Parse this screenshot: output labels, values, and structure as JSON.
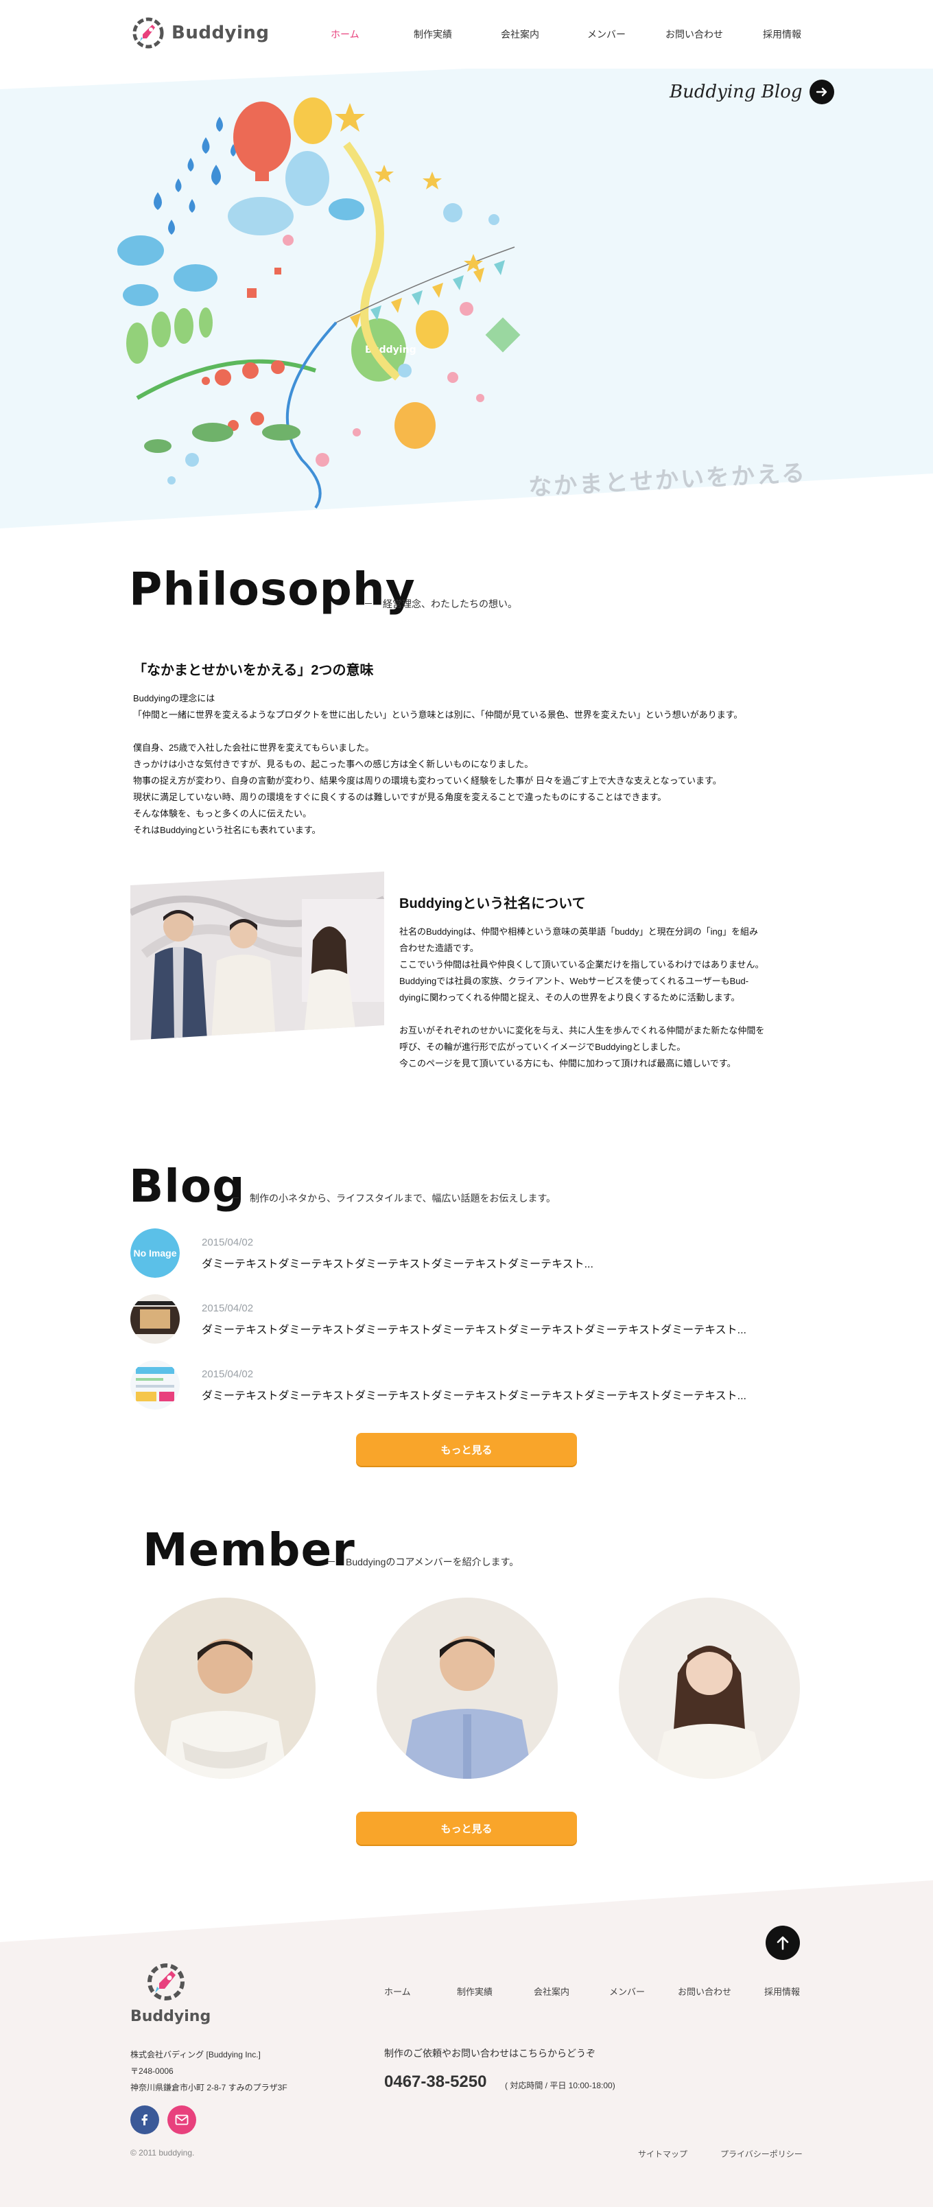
{
  "header": {
    "logo_text": "Buddying",
    "nav": [
      {
        "label": "ホーム",
        "active": true
      },
      {
        "label": "制作実績",
        "active": false
      },
      {
        "label": "会社案内",
        "active": false
      },
      {
        "label": "メンバー",
        "active": false
      },
      {
        "label": "お問い合わせ",
        "active": false
      },
      {
        "label": "採用情報",
        "active": false
      }
    ]
  },
  "hero": {
    "blog_link": "Buddying Blog",
    "catch": "なかまとせかいをかえる",
    "balloon_label": "Buddying"
  },
  "philosophy": {
    "title": "Philosophy",
    "subtitle": "－　経営理念、わたしたちの想い。",
    "meaning_heading": "「なかまとせかいをかえる」2つの意味",
    "meaning_lines": [
      "Buddyingの理念には",
      "「仲間と一緒に世界を変えるようなプロダクトを世に出したい」という意味とは別に、「仲間が見ている景色、世界を変えたい」という想いがあります。",
      "",
      "僕自身、25歳で入社した会社に世界を変えてもらいました。",
      "きっかけは小さな気付きですが、見るもの、起こった事への感じ方は全く新しいものになりました。",
      "物事の捉え方が変わり、自身の言動が変わり、結果今度は周りの環境も変わっていく経験をした事が 日々を過ごす上で大きな支えとなっています。",
      "現状に満足していない時、周りの環境をすぐに良くするのは難しいですが見る角度を変えることで違ったものにすることはできます。",
      "そんな体験を、もっと多くの人に伝えたい。",
      "それはBuddyingという社名にも表れています。"
    ],
    "about_heading": "Buddyingという社名について",
    "about_lines": [
      "社名のBuddyingは、仲間や相棒という意味の英単語「buddy」と現在分詞の「ing」を組み",
      "合わせた造語です。",
      "ここでいう仲間は社員や仲良くして頂いている企業だけを指しているわけではありません。",
      "Buddyingでは社員の家族、クライアント、Webサービスを使ってくれるユーザーもBud-",
      "dyingに関わってくれる仲間と捉え、その人の世界をより良くするために活動します。",
      "",
      "お互いがそれぞれのせかいに変化を与え、共に人生を歩んでくれる仲間がまた新たな仲間を",
      "呼び、その輪が進行形で広がっていくイメージでBuddyingとしました。",
      "今このページを見て頂いている方にも、仲間に加わって頂ければ最高に嬉しいです。"
    ]
  },
  "blog": {
    "title": "Blog",
    "subtitle": "－　制作の小ネタから、ライフスタイルまで、幅広い話題をお伝えします。",
    "no_image_label": "No Image",
    "posts": [
      {
        "date": "2015/04/02",
        "title": "ダミーテキストダミーテキストダミーテキストダミーテキストダミーテキスト..."
      },
      {
        "date": "2015/04/02",
        "title": "ダミーテキストダミーテキストダミーテキストダミーテキストダミーテキストダミーテキストダミーテキスト..."
      },
      {
        "date": "2015/04/02",
        "title": "ダミーテキストダミーテキストダミーテキストダミーテキストダミーテキストダミーテキストダミーテキスト..."
      }
    ],
    "more_label": "もっと見る"
  },
  "member": {
    "title": "Member",
    "subtitle": "－　Buddyingのコアメンバーを紹介します。",
    "more_label": "もっと見る"
  },
  "footer": {
    "logo_text": "Buddying",
    "nav": [
      "ホーム",
      "制作実績",
      "会社案内",
      "メンバー",
      "お問い合わせ",
      "採用情報"
    ],
    "company": "株式会社バディング [Buddying Inc.]",
    "zip": "〒248-0006",
    "address": "神奈川県鎌倉市小町 2-8-7 すみのプラザ3F",
    "contact_lead": "制作のご依頼やお問い合わせはこちらからどうぞ",
    "tel": "0467-38-5250",
    "hours": "( 対応時間 / 平日 10:00-18:00)",
    "copyright": "© 2011 buddying.",
    "sitemap": "サイトマップ",
    "privacy": "プライバシーポリシー"
  },
  "colors": {
    "accent_pink": "#e8417d",
    "button_orange": "#f9a52a",
    "hero_bg": "#eef8fc",
    "footer_bg": "#f7f2f1",
    "noimage_blue": "#5bc0e8"
  }
}
